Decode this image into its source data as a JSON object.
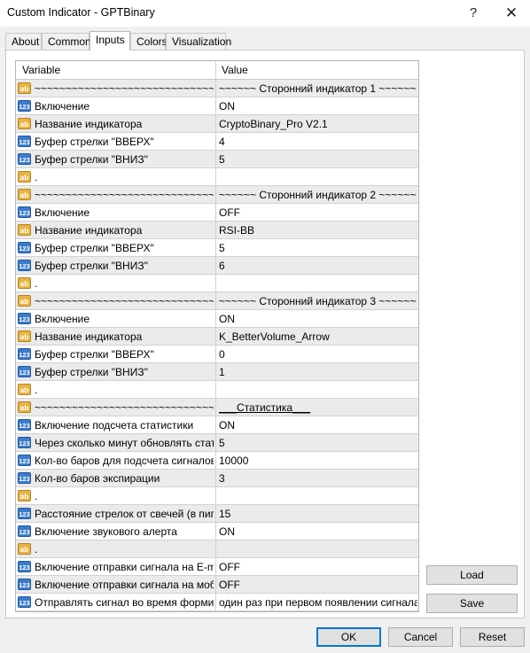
{
  "window": {
    "title": "Custom Indicator - GPTBinary",
    "help_glyph": "?",
    "close_glyph": "✕"
  },
  "tabs": [
    {
      "label": "About",
      "active": false
    },
    {
      "label": "Common",
      "active": false
    },
    {
      "label": "Inputs",
      "active": true
    },
    {
      "label": "Colors",
      "active": false
    },
    {
      "label": "Visualization",
      "active": false
    }
  ],
  "grid": {
    "headers": {
      "variable": "Variable",
      "value": "Value"
    },
    "icon_labels": {
      "str": "ab",
      "num": "123"
    },
    "rows": [
      {
        "type": "str",
        "name": "~~~~~~~~~~~~~~~~~~~~~~~~~~~~~~~~~~~~~~...",
        "value": "~~~~~~ Сторонний индикатор 1 ~~~~~~"
      },
      {
        "type": "num",
        "name": "Включение",
        "value": "ON"
      },
      {
        "type": "str",
        "name": "Название индикатора",
        "value": "CryptoBinary_Pro V2.1"
      },
      {
        "type": "num",
        "name": "Буфер стрелки \"ВВЕРХ\"",
        "value": "4"
      },
      {
        "type": "num",
        "name": "Буфер стрелки \"ВНИЗ\"",
        "value": "5"
      },
      {
        "type": "str",
        "name": ".",
        "value": ""
      },
      {
        "type": "str",
        "name": "~~~~~~~~~~~~~~~~~~~~~~~~~~~~~~~~~~~~~~...",
        "value": "~~~~~~ Сторонний индикатор 2 ~~~~~~"
      },
      {
        "type": "num",
        "name": "Включение",
        "value": "OFF"
      },
      {
        "type": "str",
        "name": "Название индикатора",
        "value": "RSI-BB"
      },
      {
        "type": "num",
        "name": "Буфер стрелки \"ВВЕРХ\"",
        "value": "5"
      },
      {
        "type": "num",
        "name": "Буфер стрелки \"ВНИЗ\"",
        "value": "6"
      },
      {
        "type": "str",
        "name": ".",
        "value": ""
      },
      {
        "type": "str",
        "name": "~~~~~~~~~~~~~~~~~~~~~~~~~~~~~~~~~~~~~~...",
        "value": "~~~~~~ Сторонний индикатор 3 ~~~~~~"
      },
      {
        "type": "num",
        "name": "Включение",
        "value": "ON"
      },
      {
        "type": "str",
        "name": "Название индикатора",
        "value": "K_BetterVolume_Arrow"
      },
      {
        "type": "num",
        "name": "Буфер стрелки \"ВВЕРХ\"",
        "value": "0"
      },
      {
        "type": "num",
        "name": "Буфер стрелки \"ВНИЗ\"",
        "value": "1"
      },
      {
        "type": "str",
        "name": ".",
        "value": ""
      },
      {
        "type": "str",
        "name": "~~~~~~~~~~~~~~~~~~~~~~~~~~~~~~~~~~~~~~...",
        "value": "___Статистика___"
      },
      {
        "type": "num",
        "name": "Включение подсчета статистики",
        "value": "ON"
      },
      {
        "type": "num",
        "name": "Через сколько минут обновлять стат...",
        "value": "5"
      },
      {
        "type": "num",
        "name": "Кол-во баров для подсчета сигналов",
        "value": "10000"
      },
      {
        "type": "num",
        "name": "Кол-во баров экспирации",
        "value": "3"
      },
      {
        "type": "str",
        "name": ".",
        "value": ""
      },
      {
        "type": "num",
        "name": "Расстояние стрелок от свечей (в пип...",
        "value": "15"
      },
      {
        "type": "num",
        "name": "Включение звукового алерта",
        "value": "ON"
      },
      {
        "type": "str",
        "name": ".",
        "value": ""
      },
      {
        "type": "num",
        "name": "Включение отправки сигнала на E-mail",
        "value": "OFF"
      },
      {
        "type": "num",
        "name": "Включение отправки сигнала на моб...",
        "value": "OFF"
      },
      {
        "type": "num",
        "name": "Отправлять сигнал во время формир...",
        "value": "один раз при первом появлении сигнала"
      }
    ]
  },
  "buttons": {
    "load": "Load",
    "save": "Save",
    "ok": "OK",
    "cancel": "Cancel",
    "reset": "Reset"
  }
}
